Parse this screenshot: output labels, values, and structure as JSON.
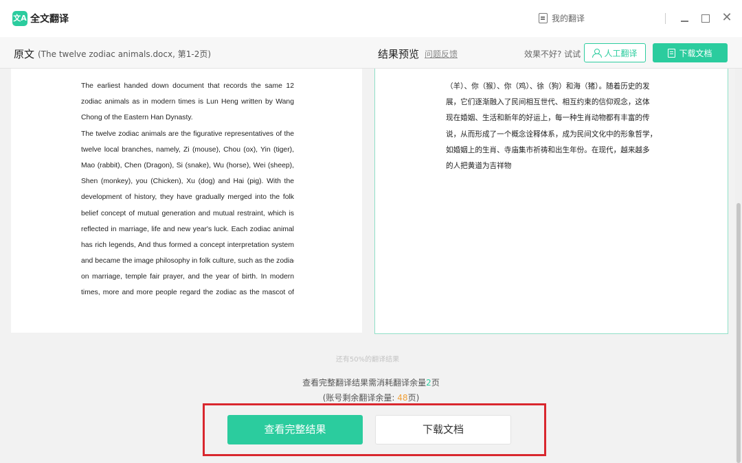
{
  "app": {
    "logo_text": "文A",
    "name": "全文翻译"
  },
  "titlebar": {
    "my_translations": "我的翻译"
  },
  "subheader": {
    "original_label": "原文",
    "original_meta": "(The twelve zodiac animals.docx,  第1-2页)",
    "preview_label": "结果预览",
    "feedback_link": "问题反馈",
    "not_good_text": "效果不好? 试试",
    "human_translate": "人工翻译",
    "download_doc": "下载文档"
  },
  "original_lines": [
    "The earliest handed down document that records the same 12",
    "zodiac animals as in modern times is Lun Heng written by Wang",
    "Chong of the Eastern Han Dynasty.",
    "The twelve zodiac animals are the figurative representatives of the",
    "twelve local branches, namely, Zi (mouse), Chou (ox), Yin (tiger),",
    "Mao (rabbit), Chen (Dragon), Si (snake), Wu (horse), Wei (sheep),",
    "Shen (monkey), you (Chicken), Xu (dog) and Hai (pig). With the",
    "development of history, they have gradually merged into the folk",
    "belief concept of mutual generation and mutual restraint, which is",
    "reflected in marriage, life and new year's luck. Each zodiac animal",
    "has rich legends, And thus formed a concept interpretation system",
    "and became the image philosophy in folk culture, such as the zodiac",
    "on marriage, temple fair prayer, and the year of birth. In modern",
    "times, more and more people regard the zodiac as the mascot of"
  ],
  "translated_lines": [
    "（羊）、你（猴）、你（鸡）、徐（狗）和海（猪）。随着历史的发",
    "展，它们逐渐融入了民间相互世代、相互约束的信仰观念，这体",
    "现在婚姻、生活和新年的好运上，每一种生肖动物都有丰富的传",
    "说，从而形成了一个概念诠释体系，成为民间文化中的形象哲学，",
    "如婚姻上的生肖、寺庙集市祈祷和出生年份。在现代，越来越多",
    "的人把黄道为吉祥物"
  ],
  "bottom": {
    "remaining_percent_text": "还有50%的翻译结果",
    "need_prefix": "查看完整翻译结果需消耗翻译余量",
    "need_pages": "2",
    "need_suffix": "页",
    "account_prefix": "(账号剩余翻译余量: ",
    "account_pages": "48",
    "account_suffix": "页)",
    "view_full_button": "查看完整结果",
    "download_button": "下载文档"
  },
  "colors": {
    "accent": "#2bcc9e",
    "highlight": "#f0a038",
    "annotation_box": "#d9272e"
  }
}
